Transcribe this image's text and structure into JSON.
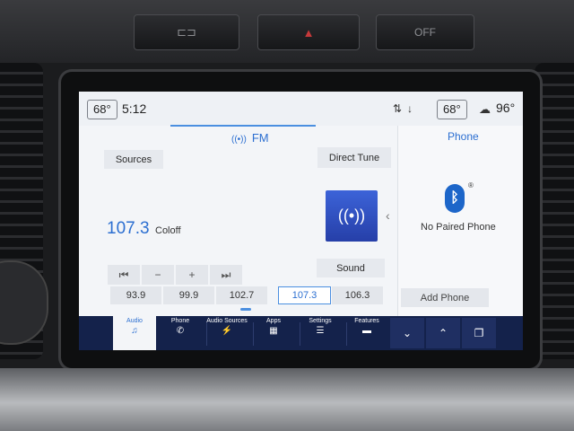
{
  "hardware": {
    "hazard_icon": "hazard-triangle-icon",
    "left_button_icon": "parking-icon",
    "right_button_label": "OFF"
  },
  "status_bar": {
    "driver_temp": "68°",
    "time": "5:12",
    "passenger_temp": "68°",
    "outside_temp": "96°",
    "icons": [
      "rear-defrost-icon",
      "seat-heat-icon",
      "weather-icon"
    ]
  },
  "audio": {
    "band": "FM",
    "sources_label": "Sources",
    "direct_tune_label": "Direct Tune",
    "frequency": "107.3",
    "station_name": "Coloff",
    "sound_label": "Sound",
    "controls": [
      "⏮",
      "−",
      "+",
      "⏭"
    ],
    "presets": [
      "93.9",
      "99.9",
      "102.7",
      "107.3",
      "106.3"
    ],
    "active_preset": "107.3"
  },
  "phone": {
    "title": "Phone",
    "status": "No Paired Phone",
    "add_label": "Add Phone"
  },
  "nav": {
    "items": [
      {
        "label": "Audio",
        "icon": "music-note-icon",
        "glyph": "♫"
      },
      {
        "label": "Phone",
        "icon": "phone-icon",
        "glyph": "✆"
      },
      {
        "label": "Audio Sources",
        "icon": "audio-sources-icon",
        "glyph": "⚡"
      },
      {
        "label": "Apps",
        "icon": "apps-grid-icon",
        "glyph": "▦"
      },
      {
        "label": "Settings",
        "icon": "settings-sliders-icon",
        "glyph": "☰"
      },
      {
        "label": "Features",
        "icon": "car-icon",
        "glyph": "▬"
      }
    ],
    "right_icons": [
      {
        "icon": "chevron-down-icon",
        "glyph": "⌄"
      },
      {
        "icon": "chevron-up-icon",
        "glyph": "⌃"
      },
      {
        "icon": "cards-icon",
        "glyph": "❐"
      }
    ]
  },
  "colors": {
    "accent": "#2c6fd1",
    "nav_background": "#14224b",
    "radio_tile": "#3559cf",
    "bluetooth": "#1d66c9"
  }
}
